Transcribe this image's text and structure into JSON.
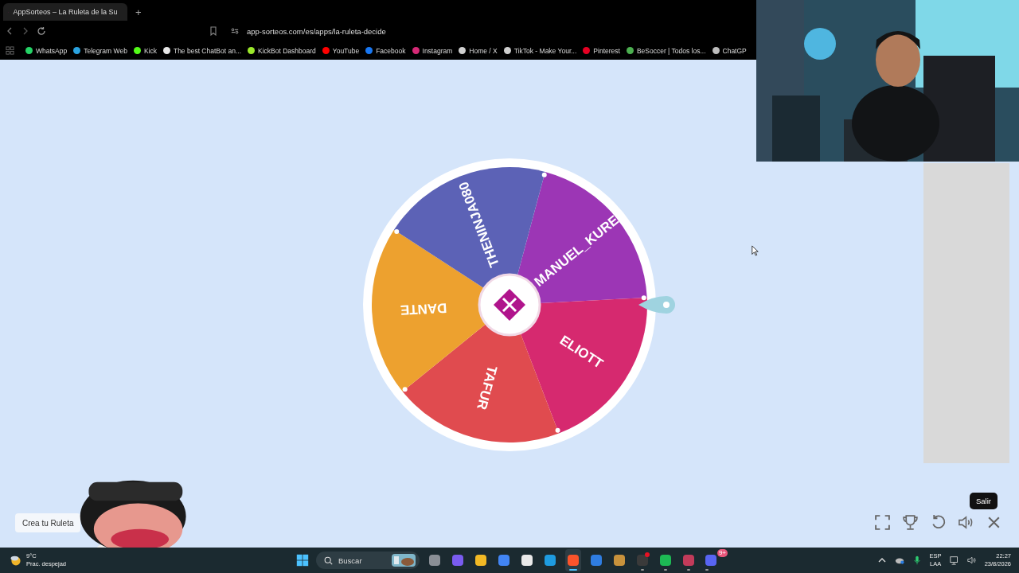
{
  "browser": {
    "tab": {
      "title": "AppSorteos – La Ruleta de la Su",
      "selected": true
    },
    "new_tab": "+",
    "url": "app-sorteos.com/es/apps/la-ruleta-decide",
    "bookmarks": [
      {
        "label": "WhatsApp",
        "color": "#25d366"
      },
      {
        "label": "Telegram Web",
        "color": "#2aa3e0"
      },
      {
        "label": "Kick",
        "color": "#53fc18"
      },
      {
        "label": "The best ChatBot an...",
        "color": "#e8e8e8"
      },
      {
        "label": "KickBot Dashboard",
        "color": "#9be82b"
      },
      {
        "label": "YouTube",
        "color": "#ff0000"
      },
      {
        "label": "Facebook",
        "color": "#1877f2"
      },
      {
        "label": "Instagram",
        "color": "#d62976"
      },
      {
        "label": "Home / X",
        "color": "#d0d0d0"
      },
      {
        "label": "TikTok - Make Your...",
        "color": "#cfcfcf"
      },
      {
        "label": "Pinterest",
        "color": "#e60023"
      },
      {
        "label": "BeSoccer | Todos los...",
        "color": "#4caf50"
      },
      {
        "label": "ChatGP",
        "color": "#bdbdbd"
      }
    ]
  },
  "wheel": {
    "segments": [
      {
        "name": "MANUEL_KURE",
        "color": "#9c36b5"
      },
      {
        "name": "ELIOTT",
        "color": "#d6296f"
      },
      {
        "name": "TAFUR",
        "color": "#e04b4f"
      },
      {
        "name": "DANTE",
        "color": "#eda12f"
      },
      {
        "name": "THENINJA080",
        "color": "#5c62b6"
      }
    ]
  },
  "create_button": "Crea tu Ruleta",
  "controls": [
    {
      "kind": "fullscreen"
    },
    {
      "kind": "trophy"
    },
    {
      "kind": "restart"
    },
    {
      "kind": "volume"
    },
    {
      "kind": "close",
      "tooltip": "Salir"
    }
  ],
  "taskbar": {
    "weather": {
      "temp": "9°C",
      "condition": "Prac. despejad"
    },
    "search": {
      "placeholder": "Buscar"
    },
    "apps": [
      {
        "color": "#8a8f96",
        "running": false,
        "selected": false
      },
      {
        "color": "#7a5cf0",
        "running": false,
        "selected": false
      },
      {
        "color": "#f2b925",
        "running": false,
        "selected": false
      },
      {
        "color": "#4285f4",
        "running": false,
        "selected": false
      },
      {
        "color": "#e9e9e9",
        "running": false,
        "selected": false
      },
      {
        "color": "#1e9be0",
        "running": false,
        "selected": false
      },
      {
        "color": "#fb542b",
        "running": true,
        "selected": true
      },
      {
        "color": "#2f7de1",
        "running": false,
        "selected": false
      },
      {
        "color": "#c8923c",
        "running": false,
        "selected": false
      },
      {
        "color": "#3a3a3a",
        "running": true,
        "selected": false,
        "dot": true
      },
      {
        "color": "#1db954",
        "running": true,
        "selected": false
      },
      {
        "color": "#c23b5a",
        "running": true,
        "selected": false
      },
      {
        "color": "#5865f2",
        "running": true,
        "selected": false,
        "badge": "9+"
      }
    ],
    "lang": "ESP",
    "layout": "LAA",
    "time": "22:27",
    "date": "23/8/2026"
  }
}
